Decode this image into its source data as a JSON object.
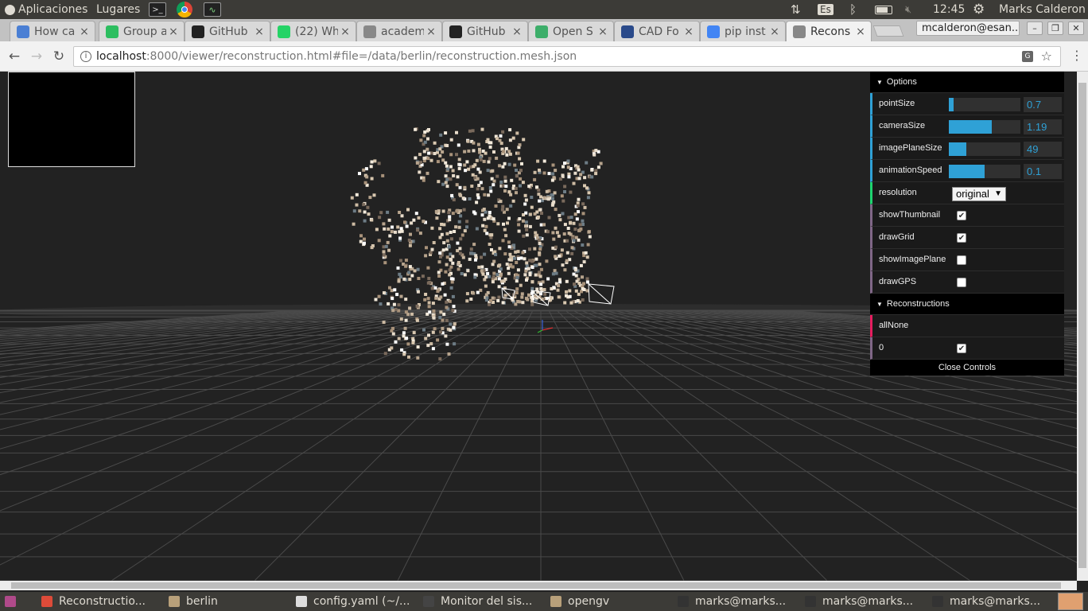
{
  "topbar": {
    "apps_label": "Aplicaciones",
    "places_label": "Lugares",
    "keyboard_layout": "Es",
    "clock": "12:45",
    "user": "Marks Calderon"
  },
  "tabs": [
    {
      "title": "How ca",
      "favicon": "google-apps-icon",
      "color": "#4a7fd4"
    },
    {
      "title": "Group a",
      "favicon": "evernote-icon",
      "color": "#2dbe60"
    },
    {
      "title": "GitHub",
      "favicon": "github-icon",
      "color": "#222222"
    },
    {
      "title": "(22) Wh",
      "favicon": "whatsapp-icon",
      "color": "#25d366"
    },
    {
      "title": "academ",
      "favicon": "page-icon",
      "color": "#888888"
    },
    {
      "title": "GitHub",
      "favicon": "github-icon",
      "color": "#222222"
    },
    {
      "title": "Open S",
      "favicon": "opensfm-icon",
      "color": "#3dae6a"
    },
    {
      "title": "CAD Fo",
      "favicon": "cad-icon",
      "color": "#2a4a8a"
    },
    {
      "title": "pip inst",
      "favicon": "google-icon",
      "color": "#4285f4"
    },
    {
      "title": "Recons",
      "favicon": "page-icon",
      "color": "#888888",
      "active": true
    }
  ],
  "profile": "mcalderon@esan...",
  "address": {
    "host": "localhost",
    "rest": ":8000/viewer/reconstruction.html#file=/data/berlin/reconstruction.mesh.json"
  },
  "gui": {
    "options_title": "Options",
    "sliders": [
      {
        "label": "pointSize",
        "value": "0.7",
        "fill": 0.07
      },
      {
        "label": "cameraSize",
        "value": "1.19",
        "fill": 0.6
      },
      {
        "label": "imagePlaneSize",
        "value": "49",
        "fill": 0.24
      },
      {
        "label": "animationSpeed",
        "value": "0.1",
        "fill": 0.5
      }
    ],
    "resolution": {
      "label": "resolution",
      "value": "original"
    },
    "checks": [
      {
        "label": "showThumbnail",
        "checked": true
      },
      {
        "label": "drawGrid",
        "checked": true
      },
      {
        "label": "showImagePlane",
        "checked": false
      },
      {
        "label": "drawGPS",
        "checked": false
      }
    ],
    "reconstructions_title": "Reconstructions",
    "all_none": "allNone",
    "recon_item": {
      "label": "0",
      "checked": true
    },
    "close_label": "Close Controls"
  },
  "taskbar": [
    {
      "label": "Reconstructio...",
      "icon": "chrome-icon",
      "color": "#dd4b39"
    },
    {
      "label": "berlin",
      "icon": "folder-icon",
      "color": "#b8a07a"
    },
    {
      "label": "config.yaml (~/...",
      "icon": "text-editor-icon",
      "color": "#dddddd"
    },
    {
      "label": "Monitor del sis...",
      "icon": "system-monitor-icon",
      "color": "#444444"
    },
    {
      "label": "opengv",
      "icon": "folder-icon",
      "color": "#b8a07a"
    },
    {
      "label": "marks@marks...",
      "icon": "terminal-icon",
      "color": "#333333"
    },
    {
      "label": "marks@marks...",
      "icon": "terminal-icon",
      "color": "#333333"
    },
    {
      "label": "marks@marks...",
      "icon": "terminal-icon",
      "color": "#333333"
    }
  ]
}
